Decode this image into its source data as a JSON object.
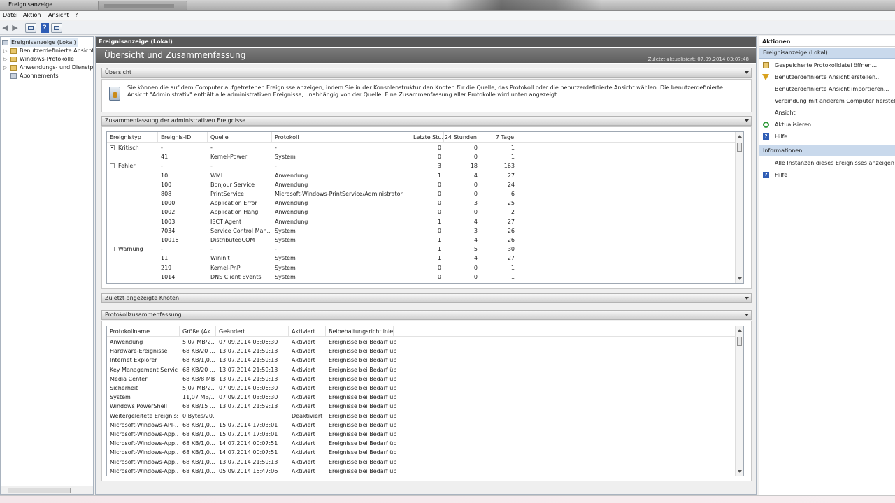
{
  "window": {
    "title": "Ereignisanzeige"
  },
  "menu": [
    "Datei",
    "Aktion",
    "Ansicht",
    "?"
  ],
  "toolbar": {
    "back_icon": "back-arrow-icon",
    "forward_icon": "forward-arrow-icon",
    "help_glyph": "?"
  },
  "tree": {
    "items": [
      {
        "label": "Ereignisanzeige (Lokal)",
        "icon": "event-viewer-icon",
        "selected": true
      },
      {
        "label": "Benutzerdefinierte Ansichten",
        "icon": "folder-icon",
        "expandable": true
      },
      {
        "label": "Windows-Protokolle",
        "icon": "folder-icon",
        "expandable": true
      },
      {
        "label": "Anwendungs- und Dienstprotokolle",
        "icon": "folder-icon",
        "expandable": true
      },
      {
        "label": "Abonnements",
        "icon": "subscriptions-icon",
        "expandable": false
      }
    ]
  },
  "center": {
    "header": "Ereignisanzeige (Lokal)",
    "banner_title": "Übersicht und Zusammenfassung",
    "last_updated": "Zuletzt aktualisiert: 07.09.2014 03:07:48",
    "overview": {
      "title": "Übersicht",
      "text": "Sie können die auf dem Computer aufgetretenen Ereignisse anzeigen, indem Sie in der Konsolenstruktur den Knoten für die Quelle, das Protokoll oder die benutzerdefinierte Ansicht wählen. Die benutzerdefinierte Ansicht \"Administrativ\" enthält alle administrativen Ereignisse, unabhängig von der Quelle. Eine Zusammenfassung aller Protokolle wird unten angezeigt."
    },
    "admin_summary": {
      "title": "Zusammenfassung der administrativen Ereignisse",
      "columns": [
        "Ereignistyp",
        "Ereignis-ID",
        "Quelle",
        "Protokoll",
        "Letzte Stu...",
        "24 Stunden",
        "7 Tage"
      ],
      "rows": [
        {
          "group": true,
          "type": "Kritisch",
          "id": "-",
          "source": "-",
          "log": "-",
          "hour": "0",
          "day": "0",
          "week": "1"
        },
        {
          "group": false,
          "type": "",
          "id": "41",
          "source": "Kernel-Power",
          "log": "System",
          "hour": "0",
          "day": "0",
          "week": "1"
        },
        {
          "group": true,
          "type": "Fehler",
          "id": "-",
          "source": "-",
          "log": "-",
          "hour": "3",
          "day": "18",
          "week": "163"
        },
        {
          "group": false,
          "type": "",
          "id": "10",
          "source": "WMI",
          "log": "Anwendung",
          "hour": "1",
          "day": "4",
          "week": "27"
        },
        {
          "group": false,
          "type": "",
          "id": "100",
          "source": "Bonjour Service",
          "log": "Anwendung",
          "hour": "0",
          "day": "0",
          "week": "24"
        },
        {
          "group": false,
          "type": "",
          "id": "808",
          "source": "PrintService",
          "log": "Microsoft-Windows-PrintService/Administrator",
          "hour": "0",
          "day": "0",
          "week": "6"
        },
        {
          "group": false,
          "type": "",
          "id": "1000",
          "source": "Application Error",
          "log": "Anwendung",
          "hour": "0",
          "day": "3",
          "week": "25"
        },
        {
          "group": false,
          "type": "",
          "id": "1002",
          "source": "Application Hang",
          "log": "Anwendung",
          "hour": "0",
          "day": "0",
          "week": "2"
        },
        {
          "group": false,
          "type": "",
          "id": "1003",
          "source": "ISCT Agent",
          "log": "Anwendung",
          "hour": "1",
          "day": "4",
          "week": "27"
        },
        {
          "group": false,
          "type": "",
          "id": "7034",
          "source": "Service Control Man...",
          "log": "System",
          "hour": "0",
          "day": "3",
          "week": "26"
        },
        {
          "group": false,
          "type": "",
          "id": "10016",
          "source": "DistributedCOM",
          "log": "System",
          "hour": "1",
          "day": "4",
          "week": "26"
        },
        {
          "group": true,
          "type": "Warnung",
          "id": "-",
          "source": "-",
          "log": "-",
          "hour": "1",
          "day": "5",
          "week": "30"
        },
        {
          "group": false,
          "type": "",
          "id": "11",
          "source": "Wininit",
          "log": "System",
          "hour": "1",
          "day": "4",
          "week": "27"
        },
        {
          "group": false,
          "type": "",
          "id": "219",
          "source": "Kernel-PnP",
          "log": "System",
          "hour": "0",
          "day": "0",
          "week": "1"
        },
        {
          "group": false,
          "type": "",
          "id": "1014",
          "source": "DNS Client Events",
          "log": "System",
          "hour": "0",
          "day": "0",
          "week": "1"
        }
      ]
    },
    "recent_nodes": {
      "title": "Zuletzt angezeigte Knoten"
    },
    "log_summary": {
      "title": "Protokollzusammenfassung",
      "columns": [
        "Protokollname",
        "Größe (Ak...",
        "Geändert",
        "Aktiviert",
        "Beibehaltungsrichtlinie"
      ],
      "rows": [
        [
          "Anwendung",
          "5,07 MB/2...",
          "07.09.2014 03:06:30",
          "Aktiviert",
          "Ereignisse bei Bedarf üb..."
        ],
        [
          "Hardware-Ereignisse",
          "68 KB/20 ...",
          "13.07.2014 21:59:13",
          "Aktiviert",
          "Ereignisse bei Bedarf üb..."
        ],
        [
          "Internet Explorer",
          "68 KB/1,0...",
          "13.07.2014 21:59:13",
          "Aktiviert",
          "Ereignisse bei Bedarf üb..."
        ],
        [
          "Key Management Service",
          "68 KB/20 ...",
          "13.07.2014 21:59:13",
          "Aktiviert",
          "Ereignisse bei Bedarf üb..."
        ],
        [
          "Media Center",
          "68 KB/8 MB",
          "13.07.2014 21:59:13",
          "Aktiviert",
          "Ereignisse bei Bedarf üb..."
        ],
        [
          "Sicherheit",
          "5,07 MB/2...",
          "07.09.2014 03:06:30",
          "Aktiviert",
          "Ereignisse bei Bedarf üb..."
        ],
        [
          "System",
          "11,07 MB/...",
          "07.09.2014 03:06:30",
          "Aktiviert",
          "Ereignisse bei Bedarf üb..."
        ],
        [
          "Windows PowerShell",
          "68 KB/15 ...",
          "13.07.2014 21:59:13",
          "Aktiviert",
          "Ereignisse bei Bedarf üb..."
        ],
        [
          "Weitergeleitete Ereignisse",
          "0 Bytes/20...",
          "",
          "Deaktiviert",
          "Ereignisse bei Bedarf üb..."
        ],
        [
          "Microsoft-Windows-API-...",
          "68 KB/1,0...",
          "15.07.2014 17:03:01",
          "Aktiviert",
          "Ereignisse bei Bedarf üb..."
        ],
        [
          "Microsoft-Windows-App...",
          "68 KB/1,0...",
          "15.07.2014 17:03:01",
          "Aktiviert",
          "Ereignisse bei Bedarf üb..."
        ],
        [
          "Microsoft-Windows-App...",
          "68 KB/1,0...",
          "14.07.2014 00:07:51",
          "Aktiviert",
          "Ereignisse bei Bedarf üb..."
        ],
        [
          "Microsoft-Windows-App...",
          "68 KB/1,0...",
          "14.07.2014 00:07:51",
          "Aktiviert",
          "Ereignisse bei Bedarf üb..."
        ],
        [
          "Microsoft-Windows-App...",
          "68 KB/1,0...",
          "13.07.2014 21:59:13",
          "Aktiviert",
          "Ereignisse bei Bedarf üb..."
        ],
        [
          "Microsoft-Windows-App...",
          "68 KB/1,0...",
          "05.09.2014 15:47:06",
          "Aktiviert",
          "Ereignisse bei Bedarf üb..."
        ]
      ]
    }
  },
  "actions": {
    "header": "Aktionen",
    "groups": [
      {
        "title": "Ereignisanzeige (Lokal)",
        "items": [
          {
            "label": "Gespeicherte Protokolldatei öffnen...",
            "icon": "open-log-icon"
          },
          {
            "label": "Benutzerdefinierte Ansicht erstellen...",
            "icon": "filter-icon"
          },
          {
            "label": "Benutzerdefinierte Ansicht importieren...",
            "icon": ""
          },
          {
            "label": "Verbindung mit anderem Computer herstellen...",
            "icon": ""
          },
          {
            "label": "Ansicht",
            "icon": ""
          },
          {
            "label": "Aktualisieren",
            "icon": "refresh-icon"
          },
          {
            "label": "Hilfe",
            "icon": "help-icon"
          }
        ]
      },
      {
        "title": "Informationen",
        "items": [
          {
            "label": "Alle Instanzen dieses Ereignisses anzeigen",
            "icon": ""
          },
          {
            "label": "Hilfe",
            "icon": "help-icon"
          }
        ]
      }
    ]
  }
}
